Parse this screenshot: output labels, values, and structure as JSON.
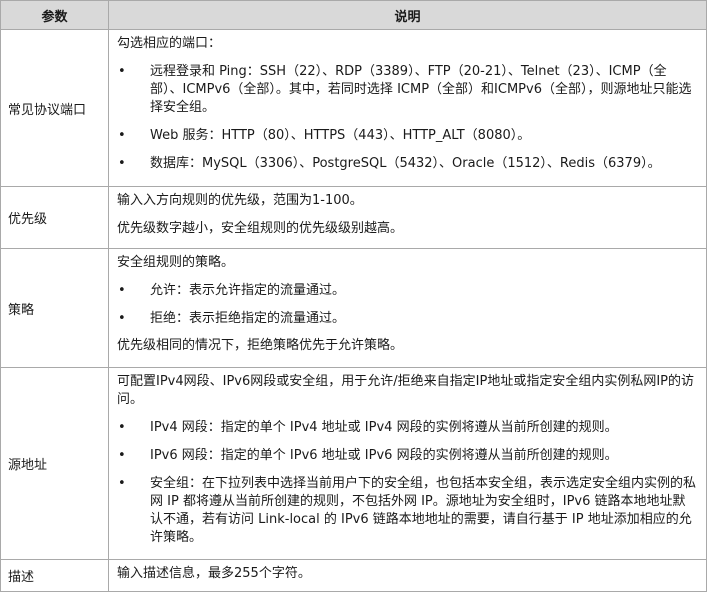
{
  "headers": {
    "param": "参数",
    "desc": "说明"
  },
  "bullet": "•",
  "rows": [
    {
      "param": "常见协议端口",
      "intro": "勾选相应的端口：",
      "bullets": [
        "远程登录和 Ping：SSH（22）、RDP（3389）、FTP（20-21）、Telnet（23）、ICMP（全部）、ICMPv6（全部）。其中，若同时选择 ICMP（全部）和ICMPv6（全部），则源地址只能选择安全组。",
        "Web 服务：HTTP（80）、HTTPS（443）、HTTP_ALT（8080）。",
        "数据库：MySQL（3306）、PostgreSQL（5432）、Oracle（1512）、Redis（6379）。"
      ]
    },
    {
      "param": "优先级",
      "lines": [
        "输入入方向规则的优先级，范围为1-100。",
        "优先级数字越小，安全组规则的优先级级别越高。"
      ]
    },
    {
      "param": "策略",
      "intro": "安全组规则的策略。",
      "bullets": [
        "允许：表示允许指定的流量通过。",
        "拒绝：表示拒绝指定的流量通过。"
      ],
      "outro": "优先级相同的情况下，拒绝策略优先于允许策略。"
    },
    {
      "param": "源地址",
      "intro": "可配置IPv4网段、IPv6网段或安全组，用于允许/拒绝来自指定IP地址或指定安全组内实例私网IP的访问。",
      "bullets": [
        "IPv4 网段：指定的单个 IPv4 地址或 IPv4 网段的实例将遵从当前所创建的规则。",
        "IPv6 网段：指定的单个 IPv6 地址或 IPv6 网段的实例将遵从当前所创建的规则。",
        "安全组：在下拉列表中选择当前用户下的安全组，也包括本安全组，表示选定安全组内实例的私网 IP 都将遵从当前所创建的规则，不包括外网 IP。源地址为安全组时，IPv6 链路本地地址默认不通，若有访问 Link-local 的 IPv6 链路本地地址的需要，请自行基于 IP 地址添加相应的允许策略。"
      ]
    },
    {
      "param": "描述",
      "lines": [
        "输入描述信息，最多255个字符。"
      ]
    }
  ]
}
